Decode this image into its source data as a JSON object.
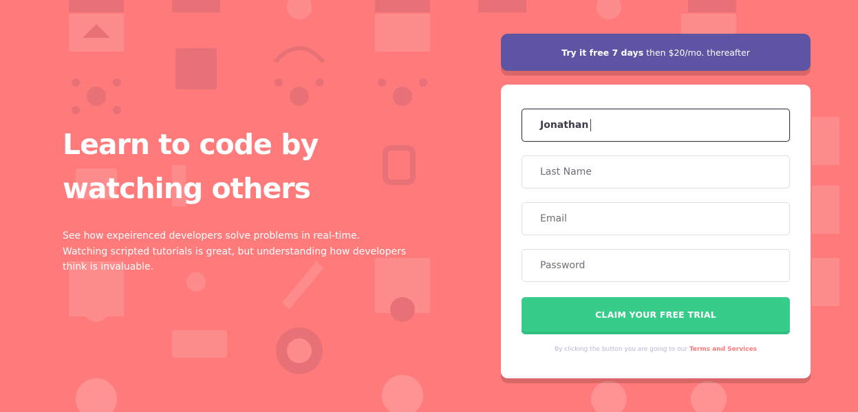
{
  "hero": {
    "headline_line1": "Learn to code by",
    "headline_line2": "watching others",
    "subtext_line1": "See how expeirenced developers solve problems in real-time.",
    "subtext_line2": "Watching scripted tutorials is great, but understanding how developers",
    "subtext_line3": "think is invaluable."
  },
  "offer": {
    "bold": "Try it free 7 days",
    "rest": "then $20/mo. thereafter"
  },
  "form": {
    "first_name": {
      "value": "Jonathan"
    },
    "last_name": {
      "placeholder": "Last Name"
    },
    "email": {
      "placeholder": "Email"
    },
    "password": {
      "placeholder": "Password"
    },
    "submit_label": "CLAIM YOUR FREE TRIAL",
    "terms_text": "By clicking the button you are going to our",
    "terms_link": "Terms and Services"
  },
  "colors": {
    "background": "#ff7a7a",
    "banner": "#5e54a4",
    "cta": "#38cc8b"
  }
}
